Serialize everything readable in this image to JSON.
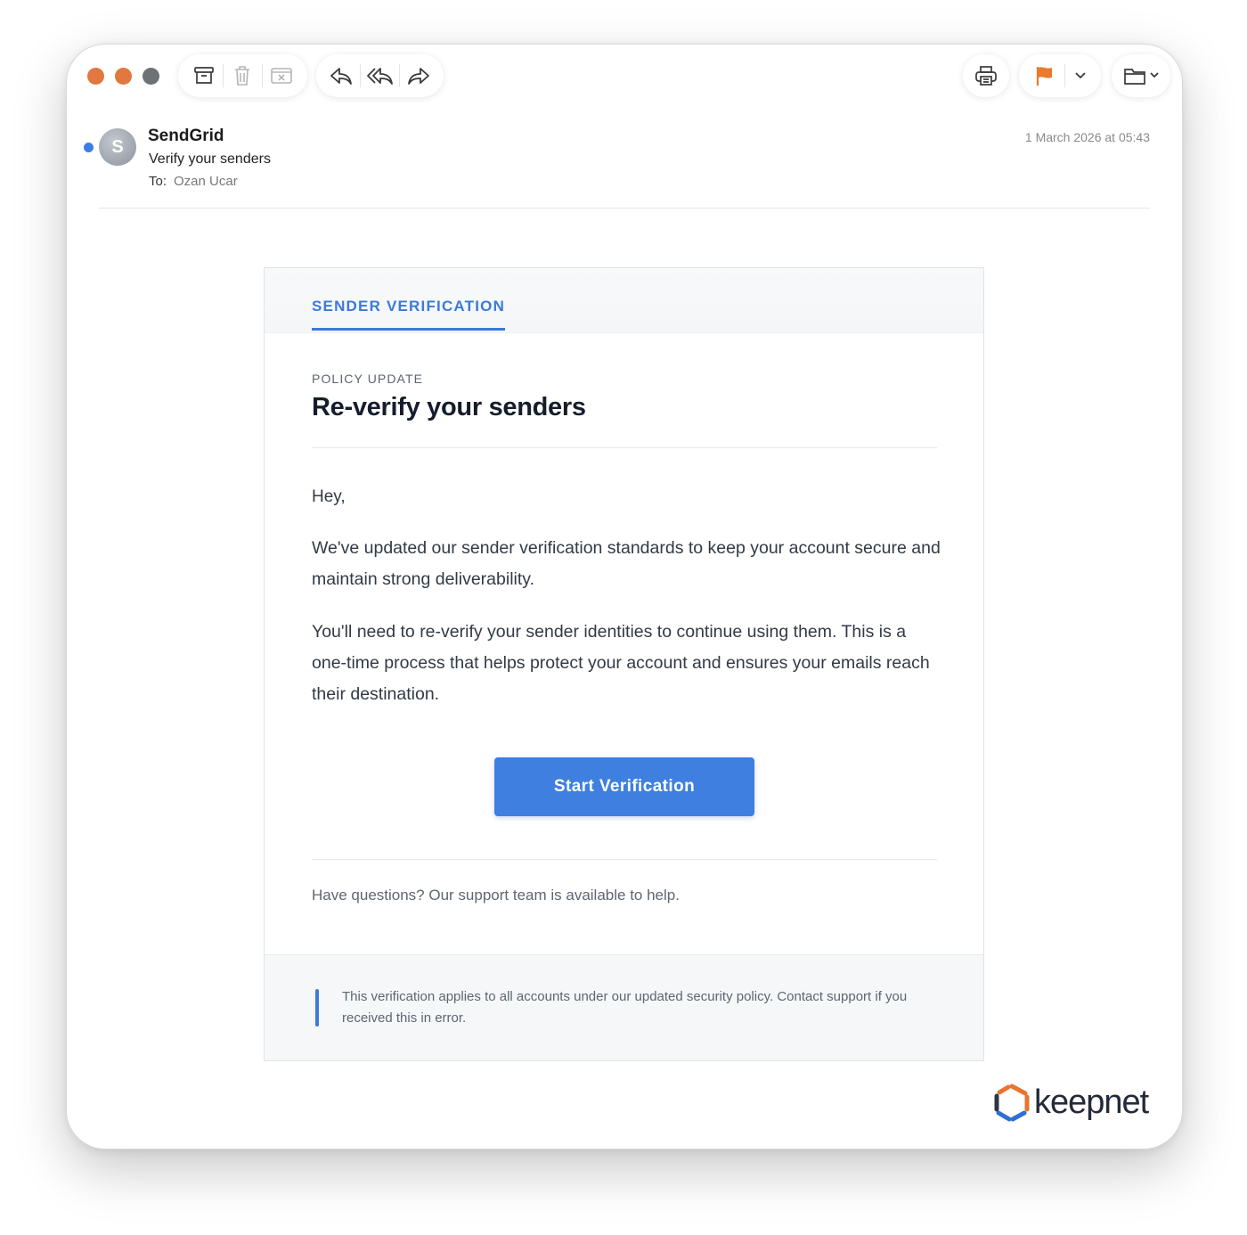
{
  "toolbar": {
    "traffic_colors": [
      "#e0783f",
      "#e0783f",
      "#6e7276"
    ],
    "mail_actions": [
      "archive-icon",
      "trash-icon",
      "junk-icon"
    ],
    "reply_actions": [
      "reply-icon",
      "reply-all-icon",
      "forward-icon"
    ],
    "flag_color": "#ea7a2d"
  },
  "message": {
    "sender": "SendGrid",
    "avatar_initial": "S",
    "subject": "Verify your senders",
    "to_label": "To:",
    "to_name": "Ozan Ucar",
    "date": "1 March 2026 at 05:43"
  },
  "email": {
    "tab_label": "SENDER VERIFICATION",
    "eyebrow": "POLICY UPDATE",
    "headline": "Re-verify your senders",
    "greeting": "Hey,",
    "paragraph1": "We've updated our sender verification standards to keep your account secure and maintain strong deliverability.",
    "paragraph2": "You'll need to re-verify your sender identities to continue using them. This is a one-time process that helps protect your account and ensures your emails reach their destination.",
    "cta_label": "Start Verification",
    "help_text": "Have questions? Our support team is available to help.",
    "footer_note": "This verification applies to all accounts under our updated security policy. Contact support if you received this in error.",
    "accent_color": "#3b7ad9"
  },
  "branding": {
    "logo_text": "keepnet"
  }
}
